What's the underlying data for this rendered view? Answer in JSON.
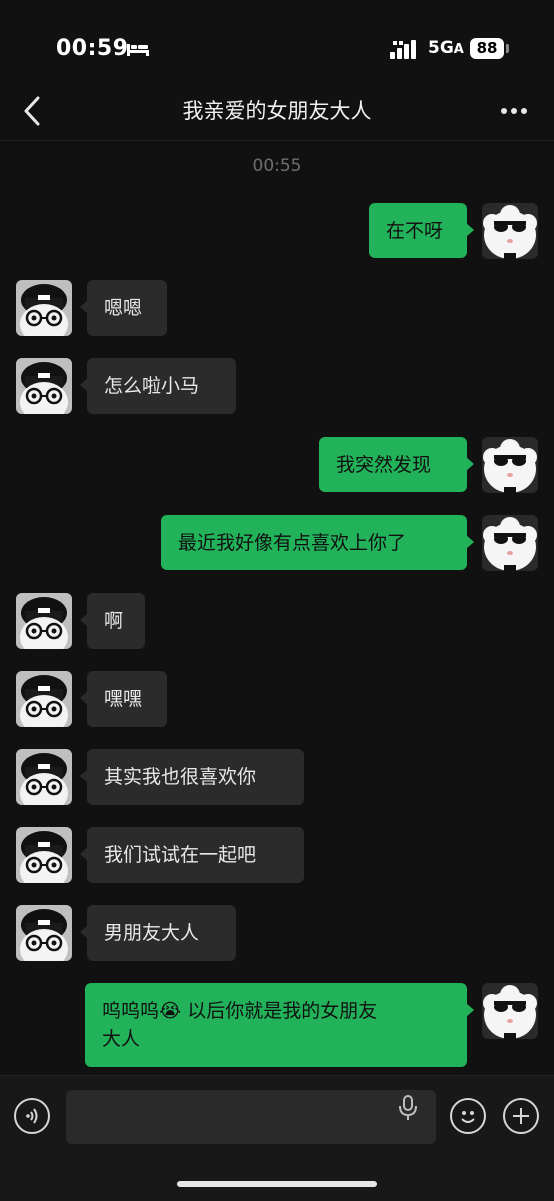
{
  "status_bar": {
    "time": "00:59",
    "network": "5G",
    "network_suffix": "A",
    "battery": "88",
    "icons": [
      "bed-icon",
      "signal-icon",
      "battery-icon"
    ]
  },
  "nav": {
    "title": "我亲爱的女朋友大人",
    "icons": [
      "back-chevron-icon",
      "more-dots-icon"
    ]
  },
  "chat": {
    "timestamp": "00:55",
    "messages": [
      {
        "side": "sent",
        "text": "在不呀"
      },
      {
        "side": "received",
        "text": "嗯嗯"
      },
      {
        "side": "received",
        "text": "怎么啦小马"
      },
      {
        "side": "sent",
        "text": "我突然发现"
      },
      {
        "side": "sent",
        "text": "最近我好像有点喜欢上你了"
      },
      {
        "side": "received",
        "text": "啊"
      },
      {
        "side": "received",
        "text": "嘿嘿"
      },
      {
        "side": "received",
        "text": "其实我也很喜欢你"
      },
      {
        "side": "received",
        "text": "我们试试在一起吧"
      },
      {
        "side": "received",
        "text": "男朋友大人"
      },
      {
        "side": "sent",
        "text_before_emoji": "呜呜呜",
        "emoji": "😭",
        "text_line1_after": " 以后你就是我的女朋友",
        "text_line2": "大人"
      }
    ]
  },
  "input_bar": {
    "text_value": "",
    "icons": [
      "voice-icon",
      "mic-icon",
      "emoji-icon",
      "plus-icon"
    ]
  },
  "colors": {
    "background": "#111111",
    "sent_bubble": "#22b35a",
    "received_bubble": "#2b2b2b",
    "timestamp": "#6f6f6f"
  }
}
